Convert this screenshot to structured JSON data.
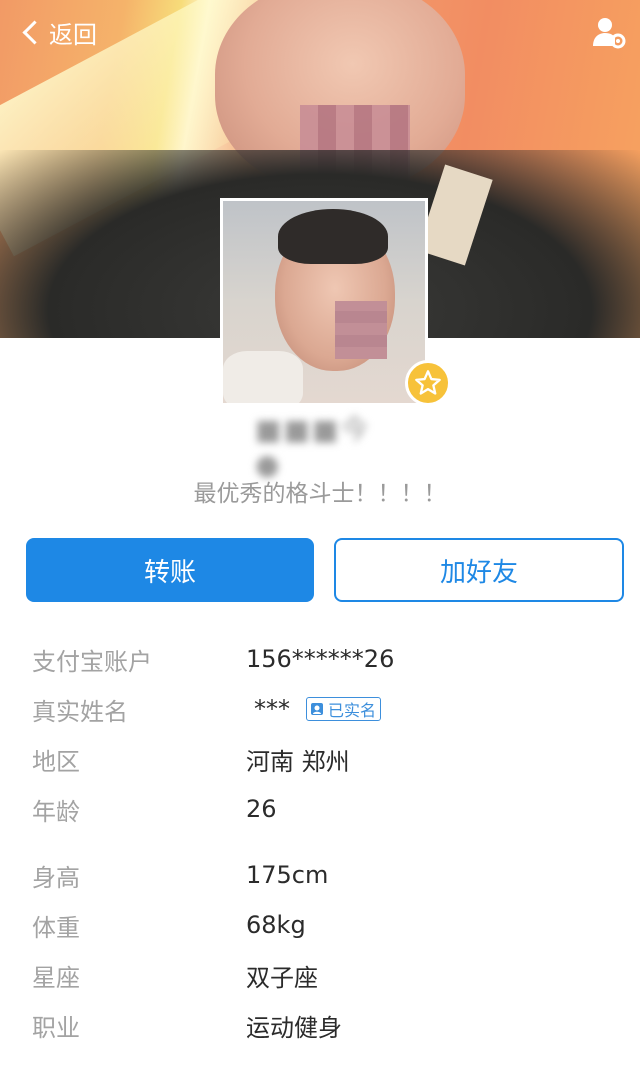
{
  "nav": {
    "back_label": "返回"
  },
  "profile": {
    "username_masked": "■■■今●",
    "signature": "最优秀的格斗士！！！！"
  },
  "actions": {
    "transfer_label": "转账",
    "add_friend_label": "加好友"
  },
  "info": [
    {
      "label": "支付宝账户",
      "value": "156******26"
    },
    {
      "label": "真实姓名",
      "value": "***",
      "badge": "已实名"
    },
    {
      "label": "地区",
      "value": "河南 郑州"
    },
    {
      "label": "年龄",
      "value": "26"
    },
    {
      "label": "身高",
      "value": "175cm"
    },
    {
      "label": "体重",
      "value": "68kg"
    },
    {
      "label": "星座",
      "value": "双子座"
    },
    {
      "label": "职业",
      "value": "运动健身"
    }
  ],
  "colors": {
    "accent": "#1e88e5",
    "star": "#f7c23a"
  },
  "icons": {
    "back": "chevron-left-icon",
    "settings": "person-gear-icon",
    "star": "star-badge-icon",
    "verified": "id-badge-icon"
  }
}
